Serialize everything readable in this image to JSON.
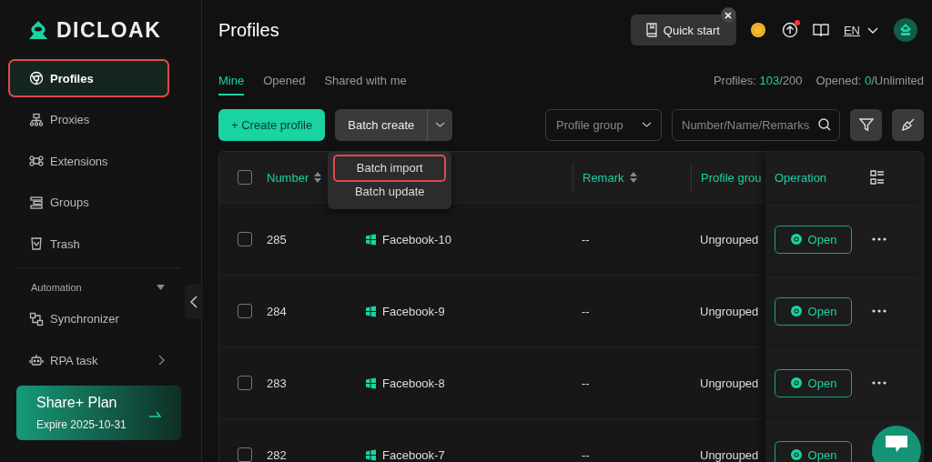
{
  "sidebar": {
    "logo": "DICLOAK",
    "items": [
      {
        "label": "Profiles",
        "selected": true,
        "highlighted": true
      },
      {
        "label": "Proxies",
        "selected": false,
        "highlighted": false
      },
      {
        "label": "Extensions",
        "selected": false,
        "highlighted": false
      },
      {
        "label": "Groups",
        "selected": false,
        "highlighted": false
      },
      {
        "label": "Trash",
        "selected": false,
        "highlighted": false
      }
    ],
    "section": {
      "label": "Automation",
      "expanded": true,
      "items": [
        {
          "label": "Synchronizer",
          "has_submenu": false
        },
        {
          "label": "RPA task",
          "has_submenu": true
        }
      ]
    },
    "plan": {
      "name": "Share+ Plan",
      "expiry": "Expire 2025-10-31"
    }
  },
  "header": {
    "title": "Profiles",
    "quick_start": "Quick start",
    "language": "EN",
    "update_badge": true
  },
  "tabs": [
    {
      "label": "Mine",
      "selected": true
    },
    {
      "label": "Opened",
      "selected": false
    },
    {
      "label": "Shared with me",
      "selected": false
    }
  ],
  "stats": {
    "profiles_label": "Profiles:",
    "profiles_used": "103",
    "profiles_total": "/200",
    "opened_label": "Opened:",
    "opened_count": "0",
    "opened_limit": "/Unlimited"
  },
  "toolbar": {
    "create": "+ Create profile",
    "batch": "Batch create",
    "group_placeholder": "Profile group",
    "search_placeholder": "Number/Name/Remarks"
  },
  "dropdown": [
    {
      "label": "Batch import",
      "highlighted": true
    },
    {
      "label": "Batch update",
      "highlighted": false
    }
  ],
  "table": {
    "all_checked": false,
    "columns": [
      {
        "label": "Number",
        "sortable": true
      },
      {
        "label": "Remark",
        "sortable": true
      },
      {
        "label": "Profile grou"
      }
    ],
    "operation": "Operation",
    "rows": [
      {
        "number": "285",
        "name": "Facebook-10",
        "remark": "--",
        "group": "Ungrouped",
        "action": "Open",
        "checked": false
      },
      {
        "number": "284",
        "name": "Facebook-9",
        "remark": "--",
        "group": "Ungrouped",
        "action": "Open",
        "checked": false
      },
      {
        "number": "283",
        "name": "Facebook-8",
        "remark": "--",
        "group": "Ungrouped",
        "action": "Open",
        "checked": false
      },
      {
        "number": "282",
        "name": "Facebook-7",
        "remark": "--",
        "group": "Ungrouped",
        "action": "Open",
        "checked": false
      }
    ]
  }
}
